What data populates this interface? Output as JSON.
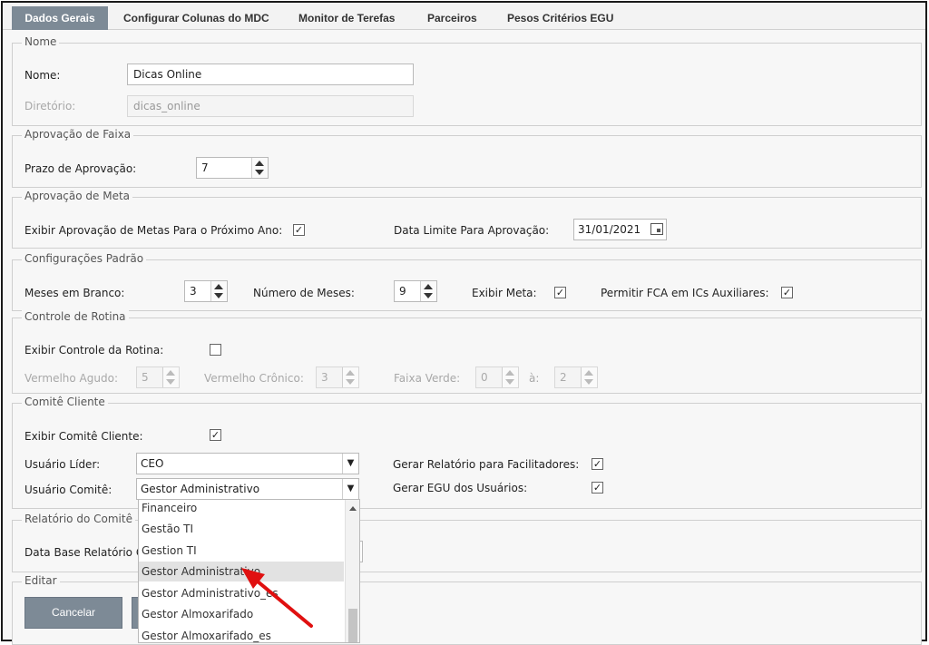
{
  "tabs": [
    {
      "label": "Dados Gerais",
      "active": true
    },
    {
      "label": "Configurar Colunas do MDC"
    },
    {
      "label": "Monitor de Terefas"
    },
    {
      "label": "Parceiros"
    },
    {
      "label": "Pesos Critérios EGU"
    }
  ],
  "nome": {
    "legend": "Nome",
    "nome_label": "Nome:",
    "nome_value": "Dicas Online",
    "diretorio_label": "Diretório:",
    "diretorio_value": "dicas_online"
  },
  "faixa": {
    "legend": "Aprovação de Faixa",
    "prazo_label": "Prazo de Aprovação:",
    "prazo_value": "7"
  },
  "meta": {
    "legend": "Aprovação de Meta",
    "exibir_label": "Exibir Aprovação de Metas Para o Próximo Ano:",
    "exibir_checked": "✓",
    "data_label": "Data Limite Para Aprovação:",
    "data_value": "31/01/2021"
  },
  "padrao": {
    "legend": "Configurações Padrão",
    "meses_branco_label": "Meses em Branco:",
    "meses_branco_value": "3",
    "numero_meses_label": "Número de Meses:",
    "numero_meses_value": "9",
    "exibir_meta_label": "Exibir Meta:",
    "exibir_meta_checked": "✓",
    "permitir_fca_label": "Permitir FCA em ICs Auxiliares:",
    "permitir_fca_checked": "✓"
  },
  "rotina": {
    "legend": "Controle de Rotina",
    "exibir_label": "Exibir Controle da Rotina:",
    "vermelho_agudo_label": "Vermelho Agudo:",
    "vermelho_agudo_value": "5",
    "vermelho_cronico_label": "Vermelho Crônico:",
    "vermelho_cronico_value": "3",
    "faixa_verde_label": "Faixa Verde:",
    "faixa_verde_value": "0",
    "a_label": "à:",
    "a_value": "2"
  },
  "comite": {
    "legend": "Comitê Cliente",
    "exibir_label": "Exibir Comitê Cliente:",
    "exibir_checked": "✓",
    "lider_label": "Usuário Líder:",
    "lider_value": "CEO",
    "comite_label": "Usuário Comitê:",
    "comite_value": "Gestor Administrativo",
    "gerar_relatorio_label": "Gerar Relatório para Facilitadores:",
    "gerar_relatorio_checked": "✓",
    "gerar_egu_label": "Gerar EGU dos Usuários:",
    "gerar_egu_checked": "✓"
  },
  "relatorio": {
    "legend": "Relatório do Comitê",
    "data_base_label": "Data Base Relatório C"
  },
  "editar": {
    "legend": "Editar",
    "cancelar_label": "Cancelar"
  },
  "dropdown": {
    "items": [
      "Financeiro",
      "Gestão TI",
      "Gestion TI",
      "Gestor Administrativo",
      "Gestor Administrativo_es",
      "Gestor Almoxarifado",
      "Gestor Almoxarifado_es"
    ],
    "highlighted": "Gestor Administrativo"
  },
  "colors": {
    "accent": "#7d8a96",
    "annotation_arrow": "#e01010"
  }
}
